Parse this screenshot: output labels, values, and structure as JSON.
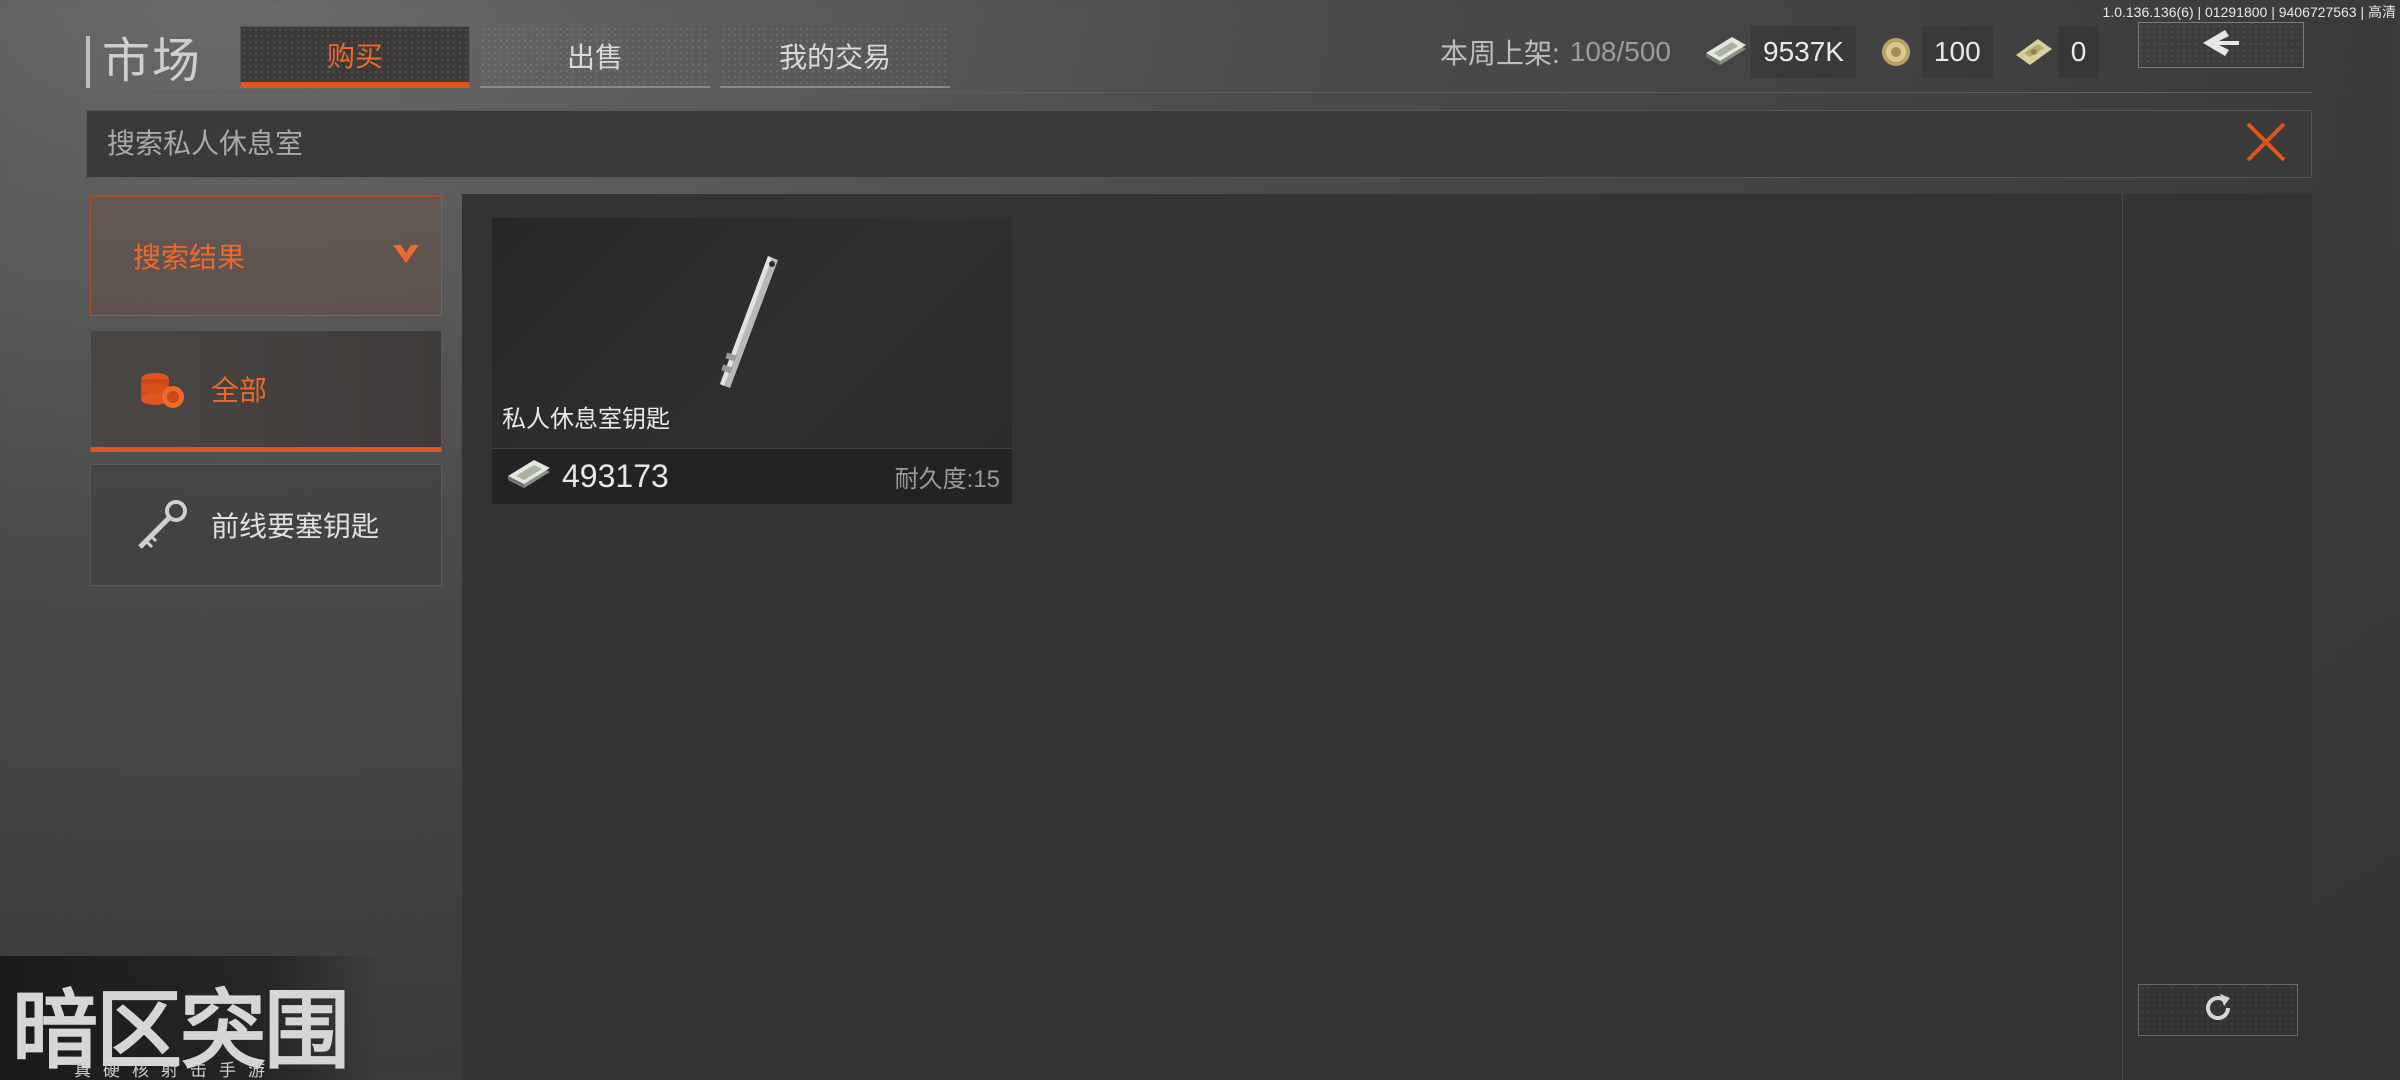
{
  "version": "1.0.136.136(6) | 01291800 | 9406727563 | 高清",
  "header": {
    "title": "市场",
    "tabs": [
      {
        "label": "购买",
        "active": true
      },
      {
        "label": "出售",
        "active": false
      },
      {
        "label": "我的交易",
        "active": false
      }
    ],
    "weekly_label": "本周上架:",
    "weekly_value": "108/500",
    "currencies": [
      {
        "icon": "cash-stack-icon",
        "value": "9537K"
      },
      {
        "icon": "gold-coin-icon",
        "value": "100"
      },
      {
        "icon": "banknote-icon",
        "value": "0"
      }
    ],
    "back_icon": "chevron-left-icon"
  },
  "search": {
    "placeholder": "搜索私人休息室",
    "value": ""
  },
  "sidebar": {
    "header_label": "搜索结果",
    "items": [
      {
        "label": "全部",
        "icon": "coin-stack-icon",
        "active": true
      },
      {
        "label": "前线要塞钥匙",
        "icon": "key-icon",
        "active": false
      }
    ]
  },
  "listing": {
    "items": [
      {
        "name": "私人休息室钥匙",
        "price": "493173",
        "durability": "耐久度:15",
        "icon": "rod-key-icon"
      }
    ]
  },
  "logo": {
    "main": "暗区突围",
    "sub": "真硬核射击手游"
  },
  "colors": {
    "accent": "#e0541d",
    "accent_text": "#ee6a2c",
    "background": "#3a3a3a"
  }
}
